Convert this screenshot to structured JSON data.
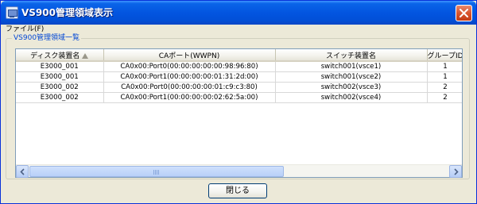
{
  "window": {
    "title": "VS900管理領域表示"
  },
  "menu": {
    "file_label": "ファイル(F)"
  },
  "group": {
    "title": "VS900管理領域一覧"
  },
  "table": {
    "columns": [
      "ディスク装置名",
      "CAポート(WWPN)",
      "スイッチ装置名",
      "グループID"
    ],
    "sort_indicator_column": "ディスク装置名",
    "rows": [
      [
        "E3000_001",
        "CA0x00:Port0(00:00:00:00:00:98:96:80)",
        "switch001(vsce1)",
        "1"
      ],
      [
        "E3000_001",
        "CA0x00:Port1(00:00:00:00:01:31:2d:00)",
        "switch001(vsce2)",
        "1"
      ],
      [
        "E3000_002",
        "CA0x00:Port0(00:00:00:00:01:c9:c3:80)",
        "switch002(vsce3)",
        "2"
      ],
      [
        "E3000_002",
        "CA0x00:Port1(00:00:00:00:02:62:5a:00)",
        "switch002(vsce4)",
        "2"
      ]
    ]
  },
  "buttons": {
    "close_label": "閉じる"
  },
  "icons": {
    "app": "app-window-icon",
    "close": "close-x-icon",
    "sort": "sort-ascending-icon",
    "scroll_left": "scroll-left-icon",
    "scroll_right": "scroll-right-icon"
  },
  "colors": {
    "titlebar": "#0355e0",
    "group_title": "#0046d5",
    "window_bg": "#ece9d8"
  }
}
